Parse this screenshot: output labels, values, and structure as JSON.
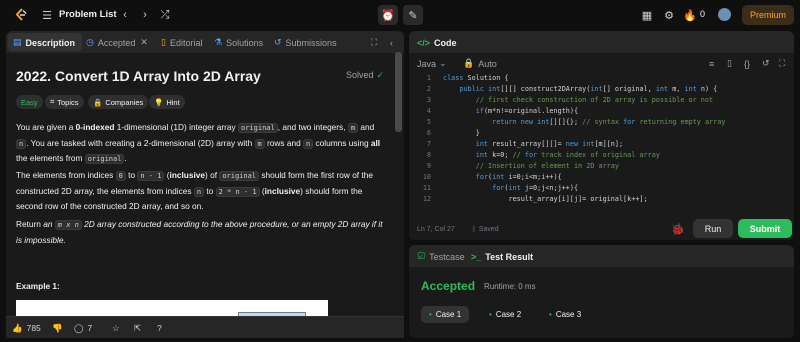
{
  "topbar": {
    "problem_list": "Problem List",
    "streak_count": "0",
    "premium": "Premium"
  },
  "left_tabs": {
    "description": "Description",
    "accepted": "Accepted",
    "editorial": "Editorial",
    "solutions": "Solutions",
    "submissions": "Submissions"
  },
  "problem": {
    "title": "2022. Convert 1D Array Into 2D Array",
    "status": "Solved",
    "chips": [
      "Easy",
      "Topics",
      "Companies",
      "Hint"
    ],
    "p1": {
      "a": "You are given a ",
      "b": "0-indexed",
      "c": " 1-dimensional (1D) integer array ",
      "d": "original",
      "e": ", and two integers, ",
      "f": "m",
      "g": " and ",
      "h": "n",
      "i": ". You are tasked with creating a 2-dimensional (2D) array with ",
      "j": "m",
      "k": " rows and ",
      "l": "n",
      "m2": " columns using ",
      "n2": "all",
      "o": " the elements from ",
      "p": "original",
      "q": "."
    },
    "p2": {
      "a": "The elements from indices ",
      "b": "0",
      "c": " to ",
      "d": "n - 1",
      "e": " (",
      "f": "inclusive",
      "g": ") of ",
      "h": "original",
      "i": " should form the first row of the constructed 2D array, the elements from indices ",
      "j": "n",
      "k": " to ",
      "l": "2 * n - 1",
      "m2": " (",
      "n2": "inclusive",
      "o": ") should form the second row of the constructed 2D array, and so on."
    },
    "p3": {
      "a": "Return ",
      "b": "an ",
      "c": "m x n",
      "d": " 2D array constructed according to the above procedure, or an empty 2D array if it is impossible."
    },
    "example_title": "Example 1:"
  },
  "bottom": {
    "likes": "785",
    "comments": "7"
  },
  "code_panel": {
    "title": "Code",
    "language": "Java",
    "auto": "Auto",
    "cursor": "Ln 7, Col 27",
    "saved": "Saved",
    "run": "Run",
    "submit": "Submit",
    "lines": [
      {
        "n": "1",
        "t": "class Solution {"
      },
      {
        "n": "2",
        "t": "    public int[][] construct2DArray(int[] original, int m, int n) {"
      },
      {
        "n": "3",
        "t": "        // first check construction of 2D array is possible or not"
      },
      {
        "n": "4",
        "t": "        if(m*n!=original.length){"
      },
      {
        "n": "5",
        "t": "            return new int[][]{}; // syntax for returning empty array"
      },
      {
        "n": "6",
        "t": "        }"
      },
      {
        "n": "7",
        "t": "        int result_array[][]= new int[m][n];"
      },
      {
        "n": "8",
        "t": "        int k=0; // for track index of original array"
      },
      {
        "n": "9",
        "t": "        // Insertion of element in 2D array"
      },
      {
        "n": "10",
        "t": "        for(int i=0;i<m;i++){"
      },
      {
        "n": "11",
        "t": "            for(int j=0;j<n;j++){"
      },
      {
        "n": "12",
        "t": "                result_array[i][j]= original[k++];"
      }
    ]
  },
  "result_panel": {
    "testcase_tab": "Testcase",
    "test_result_tab": "Test Result",
    "status": "Accepted",
    "runtime": "Runtime: 0 ms",
    "cases": [
      "Case 1",
      "Case 2",
      "Case 3"
    ]
  },
  "colors": {
    "accent_green": "#2cbb5d",
    "premium_orange": "#ffa116",
    "background": "#0f0f0f",
    "panel": "#1a1a1a"
  }
}
